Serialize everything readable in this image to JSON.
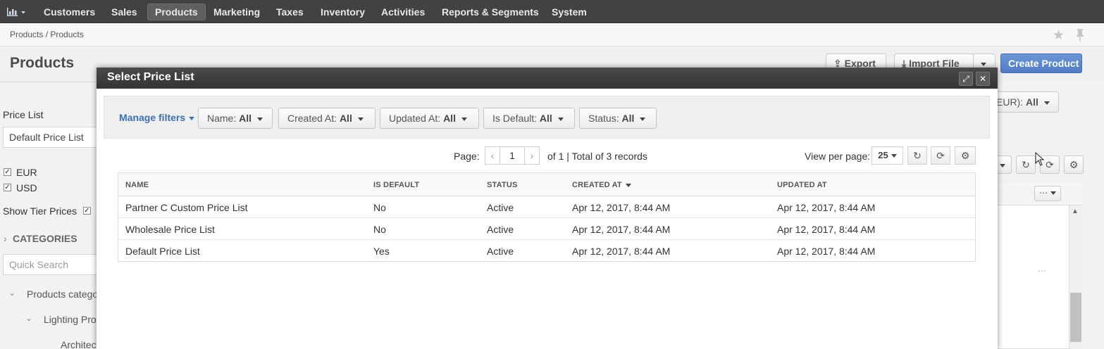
{
  "topnav": {
    "items": [
      "Customers",
      "Sales",
      "Products",
      "Marketing",
      "Taxes",
      "Inventory",
      "Activities",
      "Reports & Segments",
      "System"
    ],
    "active": "Products"
  },
  "breadcrumb": "Products / Products",
  "page": {
    "title": "Products",
    "export_label": "Export",
    "import_label": "Import File",
    "create_label": "Create Product"
  },
  "left_panel": {
    "price_list_label": "Price List",
    "price_list_value": "Default Price List",
    "currencies": [
      "EUR",
      "USD"
    ],
    "show_tier_prices": "Show Tier Prices",
    "categories_label": "CATEGORIES",
    "quick_search_placeholder": "Quick Search",
    "tree": [
      "Products categor",
      "Lighting Proc",
      "Architect"
    ]
  },
  "background_right": {
    "filter_label": "EUR): ",
    "filter_value": "All"
  },
  "modal": {
    "title": "Select Price List",
    "manage_filters": "Manage filters",
    "filters": [
      {
        "label": "Name:",
        "value": "All"
      },
      {
        "label": "Created At:",
        "value": "All"
      },
      {
        "label": "Updated At:",
        "value": "All"
      },
      {
        "label": "Is Default:",
        "value": "All"
      },
      {
        "label": "Status:",
        "value": "All"
      }
    ],
    "pager": {
      "page_label": "Page:",
      "page_value": "1",
      "total_text": "of 1 | Total of 3 records",
      "view_per_page_label": "View per page:",
      "view_per_page_value": "25"
    },
    "table": {
      "columns": [
        "NAME",
        "IS DEFAULT",
        "STATUS",
        "CREATED AT",
        "UPDATED AT"
      ],
      "rows": [
        [
          "Partner C Custom Price List",
          "No",
          "Active",
          "Apr 12, 2017, 8:44 AM",
          "Apr 12, 2017, 8:44 AM"
        ],
        [
          "Wholesale Price List",
          "No",
          "Active",
          "Apr 12, 2017, 8:44 AM",
          "Apr 12, 2017, 8:44 AM"
        ],
        [
          "Default Price List",
          "Yes",
          "Active",
          "Apr 12, 2017, 8:44 AM",
          "Apr 12, 2017, 8:44 AM"
        ]
      ]
    }
  }
}
